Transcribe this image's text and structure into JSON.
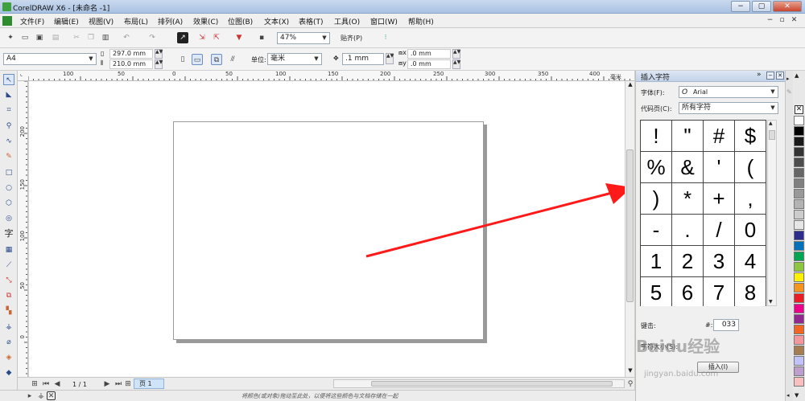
{
  "window": {
    "title": "CorelDRAW X6 - [未命名 -1]",
    "min": "−",
    "max": "▢",
    "close": "✕"
  },
  "menu": {
    "items": [
      "文件(F)",
      "编辑(E)",
      "视图(V)",
      "布局(L)",
      "排列(A)",
      "效果(C)",
      "位图(B)",
      "文本(X)",
      "表格(T)",
      "工具(O)",
      "窗口(W)",
      "帮助(H)"
    ]
  },
  "standard_toolbar": {
    "zoom": "47%",
    "snap": "贴齐(P)"
  },
  "property_bar": {
    "paper": "A4",
    "width": "297.0 mm",
    "height": "210.0 mm",
    "units_label": "单位:",
    "units": "毫米",
    "nudge": ".1 mm",
    "dup_x": ".0 mm",
    "dup_y": ".0 mm"
  },
  "toolbox": {
    "text_tool": "字"
  },
  "hruler": {
    "unit": "毫米",
    "labels": [
      "100",
      "50",
      "0",
      "50",
      "100",
      "150",
      "200",
      "250",
      "300",
      "350",
      "400"
    ]
  },
  "vruler": {
    "labels": [
      "200",
      "150",
      "100",
      "50",
      "0"
    ]
  },
  "pager": {
    "page_count": "1 / 1",
    "page_tab": "页 1"
  },
  "status": {
    "hint": "将颜色(或对象)拖动至此处，以便将这些颜色与文档存储在一起"
  },
  "docker": {
    "title": "插入字符",
    "font_label": "字体(F):",
    "font_value": "Arial",
    "code_page_label": "代码页(C):",
    "code_page_value": "所有字符",
    "chars": [
      "!",
      "\"",
      "#",
      "$",
      "%",
      "&",
      "'",
      "(",
      ")",
      "*",
      "+",
      ",",
      "-",
      ".",
      "/",
      "0",
      "1",
      "2",
      "3",
      "4",
      "5",
      "6",
      "7",
      "8"
    ],
    "keystroke_label": "键击:",
    "hash_label": "#:",
    "code_value": "033",
    "size_label": "字符大小(S):",
    "insert_button": "插入(I)"
  },
  "palette": {
    "colors": [
      "#ffffff",
      "#000000",
      "#1a1a1a",
      "#333333",
      "#4d4d4d",
      "#666666",
      "#808080",
      "#999999",
      "#b3b3b3",
      "#cccccc",
      "#e6e6e6",
      "#2b2e8c",
      "#0072bc",
      "#00a651",
      "#8dc63f",
      "#fff200",
      "#f7941d",
      "#ed1c24",
      "#ec008c",
      "#92278f",
      "#f26522",
      "#f5989d",
      "#a67c52",
      "#c2c2ff",
      "#bc9fcf",
      "#f9c0c0"
    ]
  },
  "watermark": {
    "text": "Baidu经验",
    "url": "jingyan.baidu.com"
  },
  "colors": {
    "arrow": "#ff1a1a",
    "titlebar": "#b8cde8"
  }
}
